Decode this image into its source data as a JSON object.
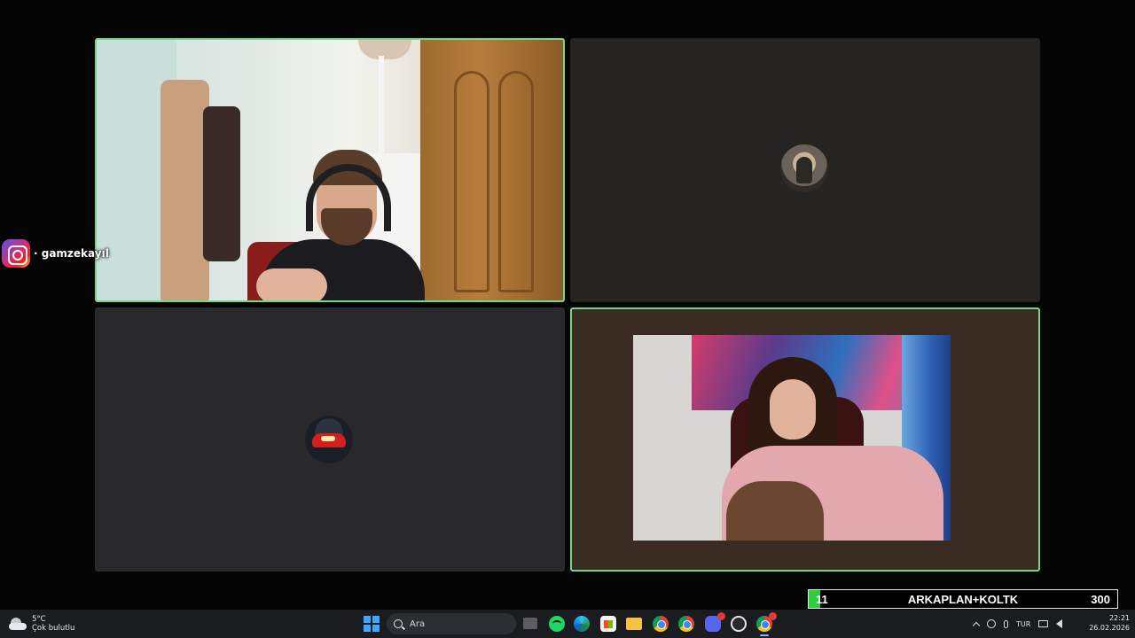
{
  "overlay": {
    "instagram_handle": "· gamzekayıl",
    "icon": "instagram-icon"
  },
  "participants": [
    {
      "id": 1,
      "video": "camera-on",
      "speaking": true
    },
    {
      "id": 2,
      "video": "avatar",
      "speaking": false
    },
    {
      "id": 3,
      "video": "avatar",
      "speaking": false
    },
    {
      "id": 4,
      "video": "camera-on",
      "speaking": true
    }
  ],
  "goal_bar": {
    "current": "11",
    "label": "ARKAPLAN+KOLTK",
    "target": "300",
    "progress": 0.0367,
    "fill_color": "#2ecc3e"
  },
  "taskbar": {
    "weather": {
      "temperature": "5°C",
      "condition": "Çok bulutlu",
      "icon": "cloud-icon"
    },
    "search": {
      "placeholder": "Ara"
    },
    "apps": [
      "task-view-icon",
      "spotify-icon",
      "edge-icon",
      "store-icon",
      "file-explorer-icon",
      "chrome-icon",
      "chrome-icon",
      "discord-icon",
      "obs-icon",
      "chrome-icon"
    ],
    "tray": {
      "language": "TUR"
    },
    "clock": {
      "time": "22:21",
      "date": "26.02.2026"
    }
  },
  "colors": {
    "speaking_border": "#6fd98a",
    "taskbar_bg": "#1b1c20",
    "windows_accent": "#3ea6ff"
  }
}
